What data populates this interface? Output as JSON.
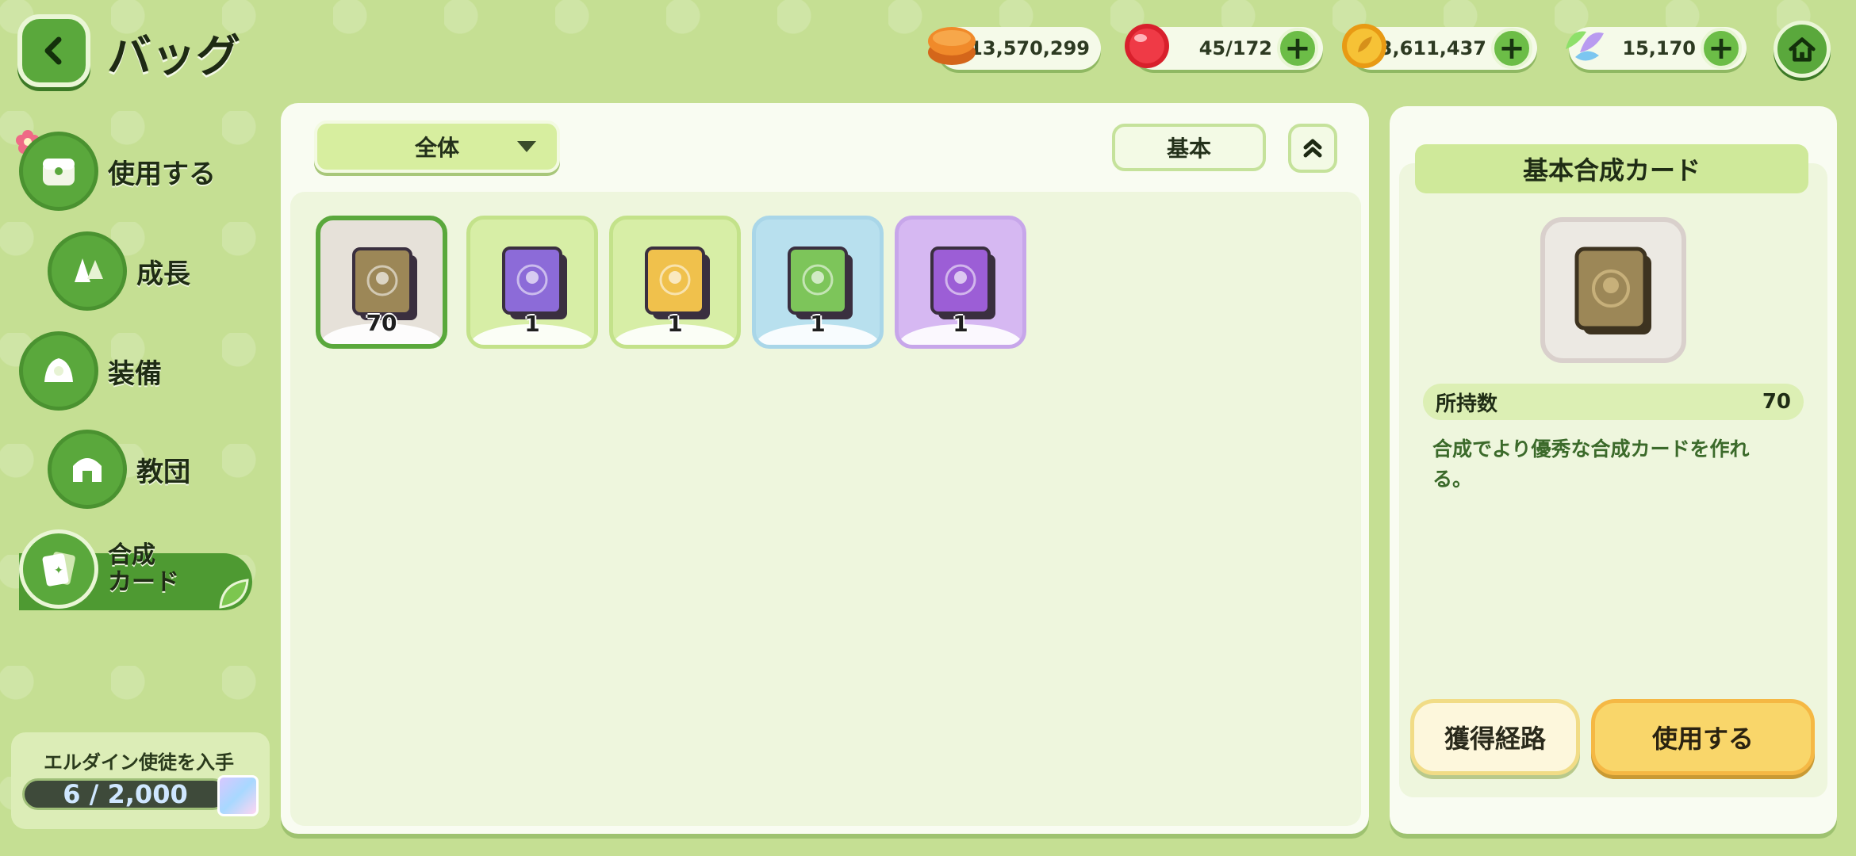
{
  "header": {
    "title": "バッグ",
    "back_icon": "chevron-left-icon",
    "home_icon": "home-icon"
  },
  "currencies": [
    {
      "name": "cookie",
      "icon": "cookie-icon",
      "value": "13,570,299",
      "has_plus": false
    },
    {
      "name": "candy",
      "icon": "red-candy-icon",
      "value": "45/172",
      "has_plus": true
    },
    {
      "name": "gold",
      "icon": "gold-coin-icon",
      "value": "3,611,437",
      "has_plus": true
    },
    {
      "name": "crystal",
      "icon": "crystal-leaf-icon",
      "value": "15,170",
      "has_plus": true
    }
  ],
  "sidebar": {
    "items": [
      {
        "label": "使用する",
        "icon": "chest-icon"
      },
      {
        "label": "成長",
        "icon": "growth-icon"
      },
      {
        "label": "装備",
        "icon": "equipment-icon"
      },
      {
        "label": "教団",
        "icon": "temple-icon"
      },
      {
        "label": "合成\nカード",
        "icon": "card-icon",
        "active": true
      }
    ],
    "progress": {
      "title": "エルダイン使徒を入手",
      "value_text": "6 / 2,000",
      "current": 6,
      "max": 2000
    }
  },
  "toolbar": {
    "filter_label": "全体",
    "sort_label": "基本"
  },
  "inventory": [
    {
      "rarity": "basic",
      "count": "70",
      "bg": "#e6e1d9",
      "border": "#5aa83c",
      "card_color": "#9c8757",
      "selected": true
    },
    {
      "rarity": "rare",
      "count": "1",
      "bg": "#d7eea6",
      "border": "#c3e28a",
      "card_color": "#8c6bd8",
      "selected": false
    },
    {
      "rarity": "epic",
      "count": "1",
      "bg": "#d7eea6",
      "border": "#c3e28a",
      "card_color": "#f0c14c",
      "selected": false
    },
    {
      "rarity": "unique",
      "count": "1",
      "bg": "#b8e0ee",
      "border": "#a9d6e8",
      "card_color": "#7dc55a",
      "selected": false
    },
    {
      "rarity": "legendary",
      "count": "1",
      "bg": "#d6b8f2",
      "border": "#c7a6ea",
      "card_color": "#9c5ed6",
      "selected": false
    }
  ],
  "detail": {
    "title": "基本合成カード",
    "owned_label": "所持数",
    "owned_value": "70",
    "description": "合成でより優秀な合成カードを作れる。",
    "route_button": "獲得経路",
    "use_button": "使用する"
  }
}
